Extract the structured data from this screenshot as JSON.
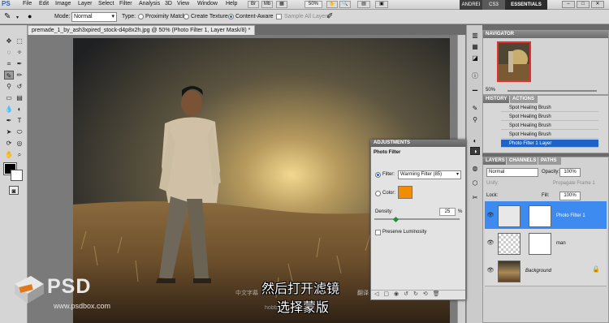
{
  "app": {
    "logo": "PS"
  },
  "menu": [
    "File",
    "Edit",
    "Image",
    "Layer",
    "Select",
    "Filter",
    "Analysis",
    "3D",
    "View",
    "Window",
    "Help"
  ],
  "menu_extras": {
    "zoom": "50%"
  },
  "workspace": {
    "user": "ANDREI",
    "cs": "CS3",
    "essentials": "ESSENTIALS"
  },
  "options": {
    "mode_label": "Mode:",
    "mode_value": "Normal",
    "type_label": "Type:",
    "types": [
      "Proximity Match",
      "Create Texture",
      "Content-Aware"
    ],
    "sample_all_layers": "Sample All Layers"
  },
  "document": {
    "tab_title": "premade_1_by_ash3xpired_stock-d4p8x2h.jpg @ 50% (Photo Filter 1, Layer Mask/8) *"
  },
  "navigator": {
    "title": "NAVIGATOR",
    "zoom": "50%"
  },
  "history": {
    "tabs": [
      "HISTORY",
      "ACTIONS"
    ],
    "items": [
      "Spot Healing Brush",
      "Spot Healing Brush",
      "Spot Healing Brush",
      "Spot Healing Brush",
      "Photo Filter 1 Layer"
    ]
  },
  "layers": {
    "tabs": [
      "LAYERS",
      "CHANNELS",
      "PATHS"
    ],
    "blend_mode": "Normal",
    "opacity_label": "Opacity:",
    "opacity": "100%",
    "unify_label": "Unify:",
    "propagate": "Propagate Frame 1",
    "lock_label": "Lock:",
    "fill_label": "Fill:",
    "fill": "100%",
    "items": [
      {
        "name": "Photo Filter 1"
      },
      {
        "name": "man"
      },
      {
        "name": "Background"
      }
    ]
  },
  "adjustments": {
    "title": "ADJUSTMENTS",
    "subtitle": "Photo Filter",
    "filter_label": "Filter:",
    "filter_value": "Warming Filter (85)",
    "color_label": "Color:",
    "filter_color": "#f28c00",
    "density_label": "Density:",
    "density_value": "25",
    "density_unit": "%",
    "density_fraction": 0.25,
    "preserve_luminosity": "Preserve Luminosity"
  },
  "overlay": {
    "subtitle_line1": "然后打开滤镜",
    "subtitle_line2": "选择蒙版",
    "watermark_line1": "中文字幕",
    "watermark_line2": "翻译",
    "watermark_shop": "hobbyo.taobao.com",
    "brand_logo": "PSD",
    "brand_url": "www.psdbox.com"
  }
}
